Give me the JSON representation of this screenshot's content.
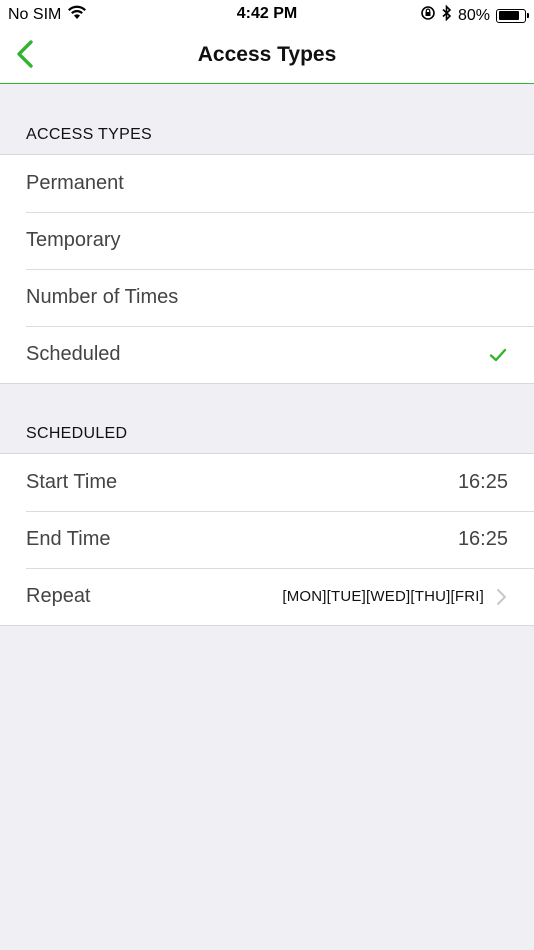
{
  "status_bar": {
    "carrier": "No SIM",
    "time": "4:42 PM",
    "battery_percent": "80%",
    "battery_level": 0.8,
    "icons": [
      "wifi-icon",
      "orientation-lock-icon",
      "bluetooth-icon",
      "battery-icon"
    ]
  },
  "nav": {
    "title": "Access Types",
    "back_icon": "chevron-left-icon",
    "accent_color": "#2fb52f"
  },
  "access_types": {
    "header": "ACCESS TYPES",
    "items": [
      {
        "label": "Permanent",
        "selected": false
      },
      {
        "label": "Temporary",
        "selected": false
      },
      {
        "label": "Number of Times",
        "selected": false
      },
      {
        "label": "Scheduled",
        "selected": true
      }
    ],
    "check_icon": "checkmark-icon"
  },
  "scheduled": {
    "header": "SCHEDULED",
    "start_time": {
      "label": "Start Time",
      "value": "16:25"
    },
    "end_time": {
      "label": "End Time",
      "value": "16:25"
    },
    "repeat": {
      "label": "Repeat",
      "value": "[MON][TUE][WED][THU][FRI]",
      "icon": "chevron-right-icon"
    }
  }
}
